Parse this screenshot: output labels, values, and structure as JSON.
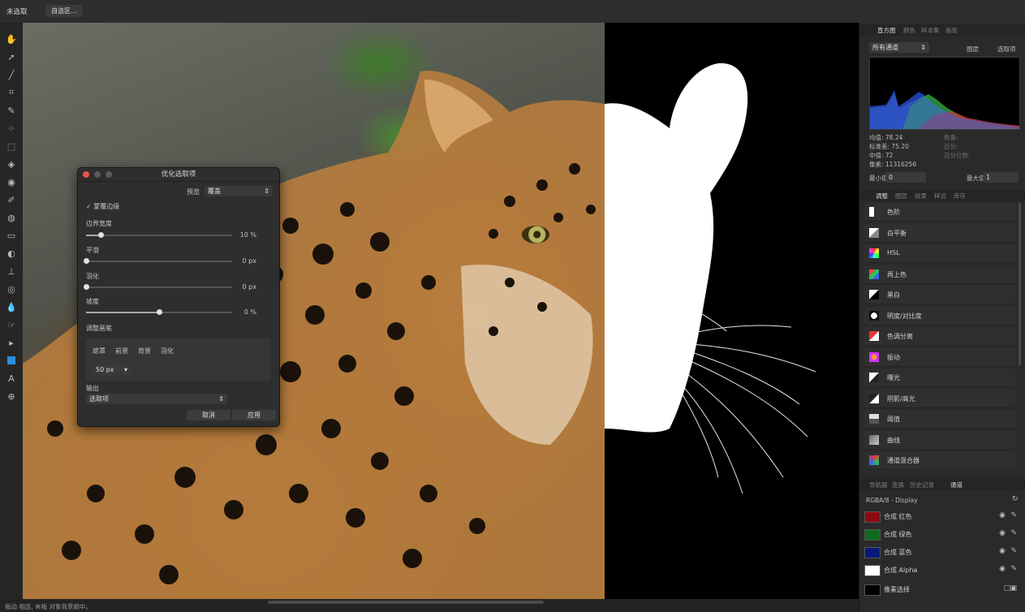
{
  "context_toolbar": {
    "label": "未选取",
    "button": "自选区..."
  },
  "canvas": {
    "colors": {
      "mask_bg": "#000000",
      "mask_fg": "#ffffff"
    }
  },
  "refine_dialog": {
    "title": "优化选取项",
    "preview_label": "预览",
    "preview_value": "覆盖",
    "matte_edges": "蒙覆边缘",
    "border_width_label": "边界宽度",
    "border_width_value": "10 %",
    "smooth_label": "平滑",
    "smooth_value": "0 px",
    "feather_label": "羽化",
    "feather_value": "0 px",
    "ramp_label": "坡度",
    "ramp_value": "0 %",
    "sliders": {
      "border_width": 0.1,
      "smooth": 0.0,
      "feather": 0.0,
      "ramp": 0.5
    },
    "brush_section": "调整画笔",
    "brush_modes": [
      "遮罩",
      "前景",
      "背景",
      "羽化"
    ],
    "brush_size": "50 px",
    "output_label": "输出",
    "output_value": "选取项",
    "cancel_label": "取消",
    "apply_label": "应用"
  },
  "histogram_panel": {
    "tabs": [
      "直方图",
      "颜色",
      "样本集",
      "画笔"
    ],
    "channel_select": "所有通道",
    "layer_option": "图层",
    "selection_option": "选取项",
    "stats": [
      "均值: 78.24",
      "标准差: 75.20",
      "中值: 72",
      "像素: 11316256"
    ],
    "stats_dim": [
      "数量:",
      "百分:",
      "百分位数:"
    ],
    "min_label": "最小值",
    "min_value": "0",
    "max_label": "最大值",
    "max_value": "1"
  },
  "adjust_panel": {
    "tabs": [
      "调整",
      "图层",
      "效果",
      "样式",
      "库存"
    ],
    "items": [
      {
        "label": "色阶",
        "icon": "levels-icon"
      },
      {
        "label": "白平衡",
        "icon": "white-balance-icon"
      },
      {
        "label": "HSL",
        "icon": "hsl-icon"
      },
      {
        "label": "再上色",
        "icon": "recolor-icon"
      },
      {
        "label": "黑白",
        "icon": "black-white-icon"
      },
      {
        "label": "明度/对比度",
        "icon": "brightness-contrast-icon"
      },
      {
        "label": "色调分离",
        "icon": "posterize-icon"
      },
      {
        "label": "振动",
        "icon": "vibrance-icon"
      },
      {
        "label": "曝光",
        "icon": "exposure-icon"
      },
      {
        "label": "阴影/高光",
        "icon": "shadows-highlights-icon"
      },
      {
        "label": "阈值",
        "icon": "threshold-icon"
      },
      {
        "label": "曲线",
        "icon": "curves-icon"
      },
      {
        "label": "通道混合器",
        "icon": "channel-mixer-icon"
      }
    ]
  },
  "channels_panel": {
    "tabs": [
      "导航器",
      "变换",
      "历史记录",
      "通道"
    ],
    "title": "RGBA/8 - Display",
    "items": [
      {
        "label": "合成 红色",
        "color": "#8b0a12"
      },
      {
        "label": "合成 绿色",
        "color": "#0f6b1c"
      },
      {
        "label": "合成 蓝色",
        "color": "#0b1a7a"
      },
      {
        "label": "合成 Alpha",
        "color": "#ffffff"
      }
    ],
    "pixel_selection": "像素选择"
  },
  "status_bar": {
    "text": "拖动 相连, ⌘拖 对象背景颜中。"
  }
}
